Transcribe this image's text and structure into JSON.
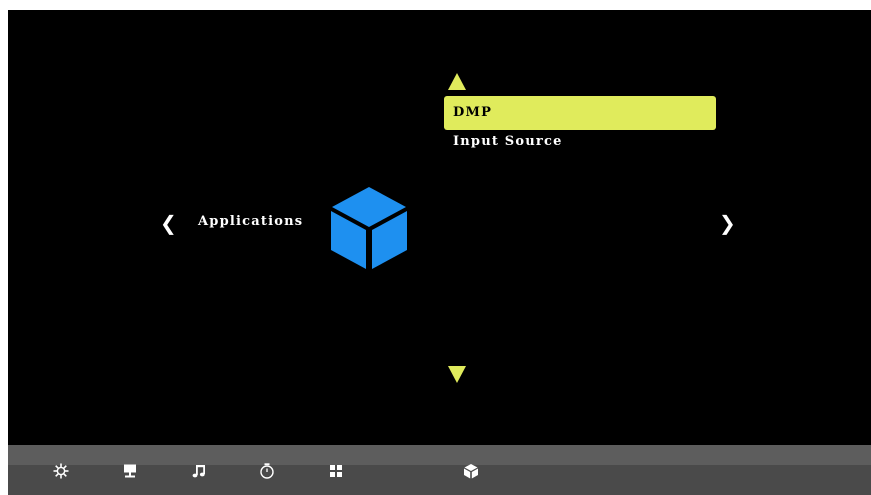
{
  "menu": {
    "items": [
      {
        "label": "DMP",
        "selected": true
      },
      {
        "label": "Input Source",
        "selected": false
      }
    ],
    "up_icon": "triangle-up-icon",
    "down_icon": "triangle-down-icon"
  },
  "category": {
    "label": "Applications",
    "icon": "cube-icon",
    "prev_icon": "chevron-left-icon",
    "next_icon": "chevron-right-icon",
    "prev_glyph": "❮",
    "next_glyph": "❯"
  },
  "bottom_bar": {
    "icons": [
      "settings-icon",
      "display-icon",
      "music-icon",
      "clock-icon",
      "apps-grid-icon",
      "cube-icon"
    ],
    "active_icon": "cube-icon"
  },
  "colors": {
    "highlight": "#e0eb5c",
    "cube": "#1e90f0",
    "background": "#000000",
    "bar": "#4a4a4a"
  }
}
